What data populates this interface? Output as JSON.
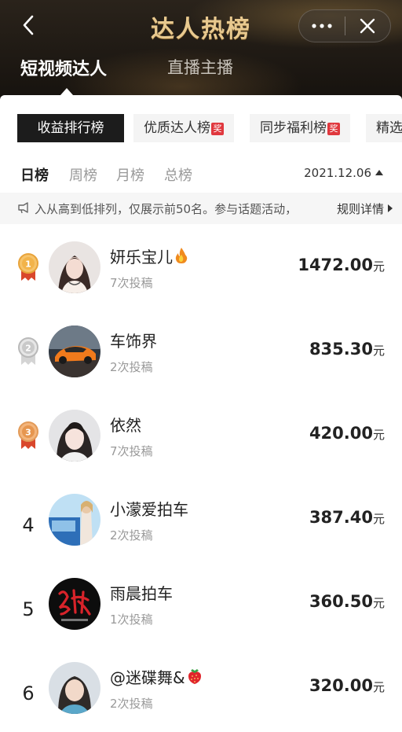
{
  "header": {
    "title": "达人热榜",
    "tabs": [
      {
        "label": "短视频达人",
        "active": true
      },
      {
        "label": "直播主播",
        "active": false
      }
    ]
  },
  "filters": {
    "chips": [
      {
        "label": "收益排行榜",
        "active": true,
        "award": ""
      },
      {
        "label": "优质达人榜",
        "active": false,
        "award": "奖"
      },
      {
        "label": "同步福利榜",
        "active": false,
        "award": "奖"
      },
      {
        "label": "精选",
        "active": false,
        "award": ""
      }
    ]
  },
  "periods": {
    "items": [
      {
        "label": "日榜",
        "active": true
      },
      {
        "label": "周榜",
        "active": false
      },
      {
        "label": "月榜",
        "active": false
      },
      {
        "label": "总榜",
        "active": false
      }
    ],
    "date": "2021.12.06"
  },
  "notice": {
    "text": "入从高到低排列，仅展示前50名。参与话题活动，",
    "link": "规则详情"
  },
  "ranking": {
    "unit": "元",
    "rows": [
      {
        "rank": "1",
        "name": "妍乐宝儿",
        "emoji": "fire",
        "posts": "7次投稿",
        "amount": "1472.00"
      },
      {
        "rank": "2",
        "name": "车饰界",
        "emoji": "",
        "posts": "2次投稿",
        "amount": "835.30"
      },
      {
        "rank": "3",
        "name": "依然",
        "emoji": "",
        "posts": "7次投稿",
        "amount": "420.00"
      },
      {
        "rank": "4",
        "name": "小濛爱拍车",
        "emoji": "",
        "posts": "2次投稿",
        "amount": "387.40"
      },
      {
        "rank": "5",
        "name": "雨晨拍车",
        "emoji": "",
        "posts": "1次投稿",
        "amount": "360.50"
      },
      {
        "rank": "6",
        "name": "@迷碟舞&",
        "emoji": "strawberry",
        "posts": "2次投稿",
        "amount": "320.00"
      }
    ]
  },
  "colors": {
    "gold": "#e8a33a",
    "silver": "#b9b9b9",
    "bronze": "#e29a58",
    "award": "#e0383e"
  }
}
